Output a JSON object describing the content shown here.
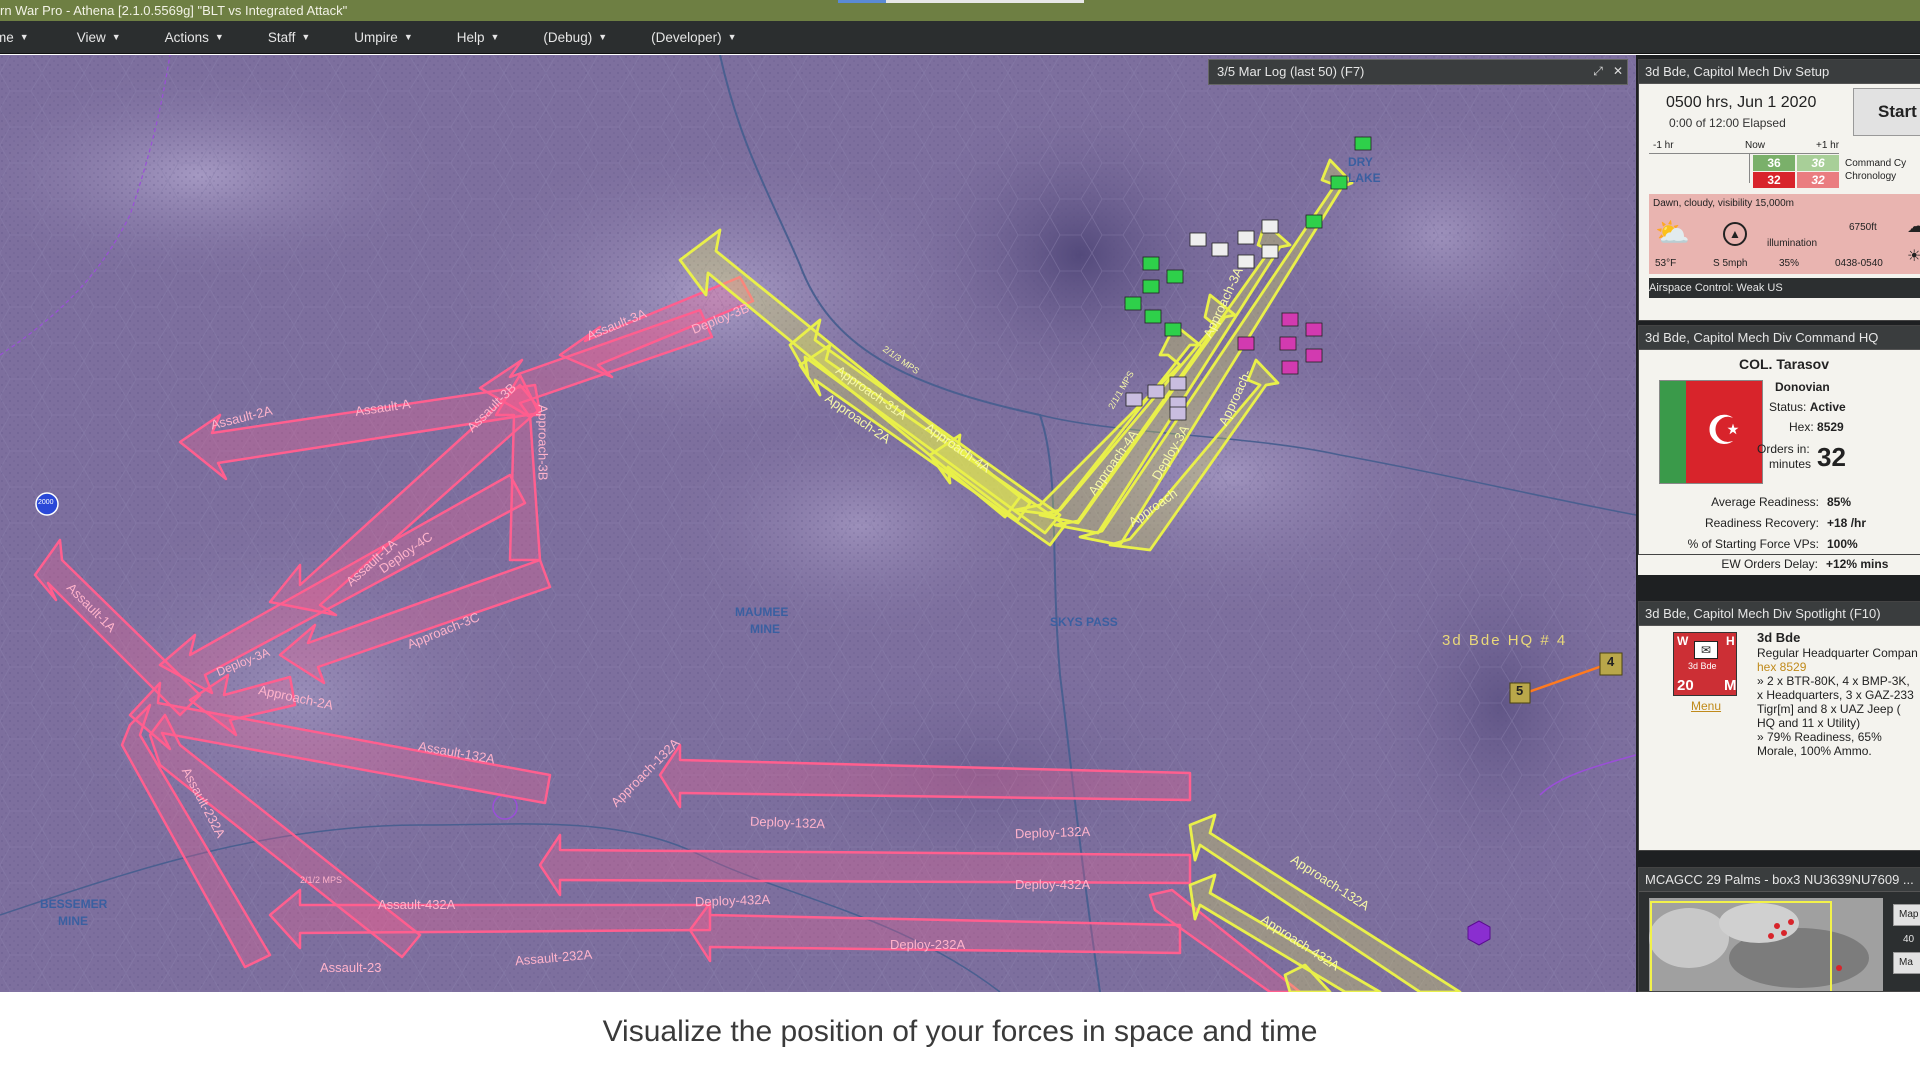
{
  "window": {
    "title": "rn War Pro - Athena  [2.1.0.5569g]  \"BLT vs Integrated Attack\""
  },
  "menu": {
    "items": [
      {
        "label": "me"
      },
      {
        "label": "View"
      },
      {
        "label": "Actions"
      },
      {
        "label": "Staff"
      },
      {
        "label": "Umpire"
      },
      {
        "label": "Help"
      },
      {
        "label": "(Debug)"
      },
      {
        "label": "(Developer)"
      }
    ]
  },
  "log_window": {
    "title": "3/5 Mar Log (last 50)   (F7)"
  },
  "map": {
    "place_labels": {
      "maumee_1": "MAUMEE",
      "maumee_2": "MINE",
      "bessemer_1": "BESSEMER",
      "bessemer_2": "MINE",
      "pass": "SKYS PASS",
      "lake_1": "DRY",
      "lake_2": "LAKE",
      "unit_marker_top": "2000",
      "hq_label": "3d Bde HQ # 4"
    },
    "hex_markers": {
      "marker_4": "4",
      "marker_5": "5"
    },
    "pink_arrows": [
      "Assault-2A",
      "Assault-A",
      "Assault-3A",
      "Approach-3B",
      "Assault-3B",
      "Deploy-3B",
      "Assault-1A",
      "Deploy-4C",
      "Approach-3C",
      "Deploy-3A",
      "Approach-2A",
      "Assault-1A",
      "Assault-132A",
      "Approach-132A",
      "Assault-232A",
      "Deploy-132A",
      "Deploy-132A",
      "Deploy-432A",
      "Deploy-432A",
      "Assault-432A",
      "Deploy-232A",
      "Assault-232A",
      "Assault-23"
    ],
    "yellow_arrows": [
      "Approach-31A",
      "Approach-2A",
      "Approach-4A",
      "Approach-4A",
      "Deploy-3A",
      "Approach-3A",
      "Approach-",
      "Approach",
      "Approach-132A",
      "Approach-432A"
    ],
    "sub_labels": {
      "mph_1": "2/1/1 MPS",
      "mph_2": "2/1/2 MPS",
      "mph_3": "2/1/3 MPS"
    }
  },
  "setup_panel": {
    "header": "3d Bde, Capitol Mech Div Setup",
    "time": "0500 hrs, Jun 1 2020",
    "elapsed": "0:00 of 12:00 Elapsed",
    "start_label": "Start",
    "timeline_left": "-1 hr",
    "timeline_mid": "Now",
    "timeline_right": "+1 hr",
    "cycle_green_a": "36",
    "cycle_green_b": "36",
    "cycle_red_a": "32",
    "cycle_red_b": "32",
    "command_cycle_label": "Command Cy",
    "chronology_label": "Chronology",
    "weather_text": "Dawn, cloudy, visibility 15,000m",
    "temp": "53°F",
    "wind": "S 5mph",
    "illum_label": "illumination",
    "illum_val": "35%",
    "altitude": "6750ft",
    "times": "0438-0540",
    "airspace": "Airspace Control: Weak US"
  },
  "hq_panel": {
    "header": "3d Bde, Capitol Mech Div Command HQ",
    "commander": "COL. Tarasov",
    "name": "Donovian",
    "status_label": "Status:",
    "status_value": "Active",
    "hex_label": "Hex:",
    "hex_value": "8529",
    "orders_label_1": "Orders in:",
    "orders_label_2": "minutes",
    "orders_value": "32",
    "stats": [
      {
        "label": "Average Readiness:",
        "value": "85%"
      },
      {
        "label": "Readiness Recovery:",
        "value": "+18 /hr"
      },
      {
        "label": "% of Starting Force VPs:",
        "value": "100%"
      },
      {
        "label": "EW Orders Delay:",
        "value": "+12% mins"
      }
    ],
    "colors": {
      "flag_green": "#3a9a4a",
      "flag_red": "#d8242b"
    }
  },
  "spotlight_panel": {
    "header": "3d Bde, Capitol Mech Div Spotlight   (F10)",
    "counter_top_left": "W",
    "counter_top_right": "H",
    "counter_name": "3d Bde",
    "counter_strength": "20",
    "counter_bottom_right": "M",
    "menu_link": "Menu",
    "unit_name": "3d Bde",
    "unit_type": "Regular Headquarter Compan",
    "hex": "hex 8529",
    "desc_lines": [
      "» 2 x BTR-80K, 4 x BMP-3K,",
      "x Headquarters, 3 x GAZ-233",
      "Tigr[m] and 8 x UAZ Jeep (",
      "HQ and 11 x Utility)",
      "» 79% Readiness, 65%",
      "Morale, 100% Ammo."
    ]
  },
  "minimap_panel": {
    "header": "MCAGCC 29 Palms - box3 NU3639NU7609 ...",
    "btn_1": "Map",
    "zoom_value": "40",
    "btn_2": "Ma"
  },
  "caption": {
    "text": "Visualize the position of your forces in space and time"
  },
  "colors": {
    "titlebar": "#6e7f43",
    "menubar": "#2b2e2f",
    "terrain": "#7d6f9e",
    "pink_arrow": "#ff5f8f",
    "yellow_arrow": "#e9f04a"
  }
}
